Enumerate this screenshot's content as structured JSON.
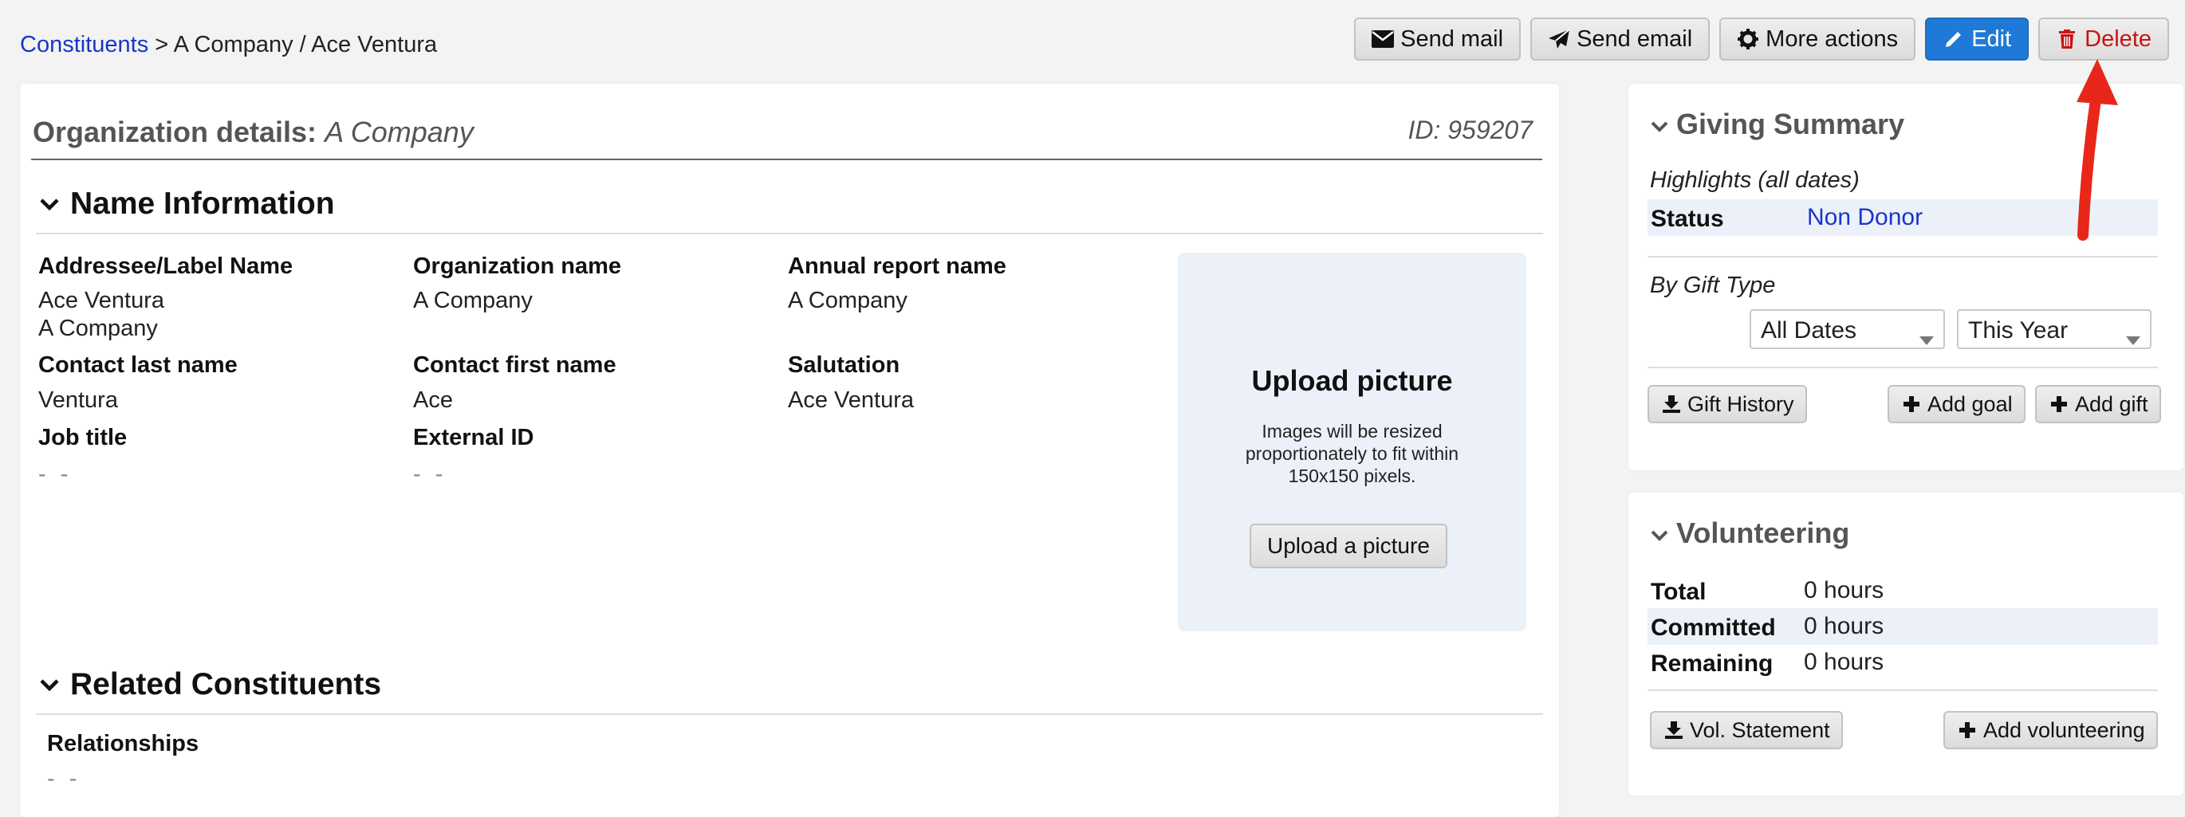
{
  "breadcrumb": {
    "link": "Constituents",
    "separator": ">",
    "current": "A Company / Ace Ventura"
  },
  "actions": {
    "send_mail": "Send mail",
    "send_email": "Send email",
    "more_actions": "More actions",
    "edit": "Edit",
    "delete": "Delete"
  },
  "details": {
    "title_lead": "Organization details:",
    "title_org": "A Company",
    "id": "ID: 959207"
  },
  "name_info": {
    "heading": "Name Information",
    "fields": {
      "addressee_label": "Addressee/Label Name",
      "addressee_line1": "Ace Ventura",
      "addressee_line2": "A Company",
      "org_name_label": "Organization name",
      "org_name_value": "A Company",
      "annual_label": "Annual report name",
      "annual_value": "A Company",
      "contact_last_label": "Contact last name",
      "contact_last_value": "Ventura",
      "contact_first_label": "Contact first name",
      "contact_first_value": "Ace",
      "salutation_label": "Salutation",
      "salutation_value": "Ace Ventura",
      "job_title_label": "Job title",
      "job_title_value": "- -",
      "external_id_label": "External ID",
      "external_id_value": "- -"
    },
    "upload": {
      "title": "Upload picture",
      "note": "Images will be resized proportionately to fit within 150x150 pixels.",
      "button": "Upload a picture"
    }
  },
  "related": {
    "heading": "Related Constituents",
    "relationships_label": "Relationships",
    "relationships_value": "- -"
  },
  "giving": {
    "heading": "Giving Summary",
    "highlights": "Highlights (all dates)",
    "status_label": "Status",
    "status_value": "Non Donor",
    "by_gift_type": "By Gift Type",
    "date_select": "All Dates",
    "year_select": "This Year",
    "gift_history": "Gift History",
    "add_goal": "Add goal",
    "add_gift": "Add gift"
  },
  "volunteering": {
    "heading": "Volunteering",
    "rows": [
      {
        "label": "Total",
        "value": "0 hours"
      },
      {
        "label": "Committed",
        "value": "0 hours"
      },
      {
        "label": "Remaining",
        "value": "0 hours"
      }
    ],
    "vol_statement": "Vol. Statement",
    "add_volunteering": "Add volunteering"
  },
  "colors": {
    "link": "#1a35c8",
    "primary": "#1f79d6",
    "danger": "#c81313",
    "highlight_row": "#ecf1f9",
    "annotation_arrow": "#e8271a"
  },
  "icons": [
    "envelope-icon",
    "paper-plane-icon",
    "gear-icon",
    "pencil-icon",
    "trash-icon",
    "chevron-down-icon",
    "download-icon",
    "plus-icon",
    "caret-down-icon",
    "arrow-annotation"
  ]
}
